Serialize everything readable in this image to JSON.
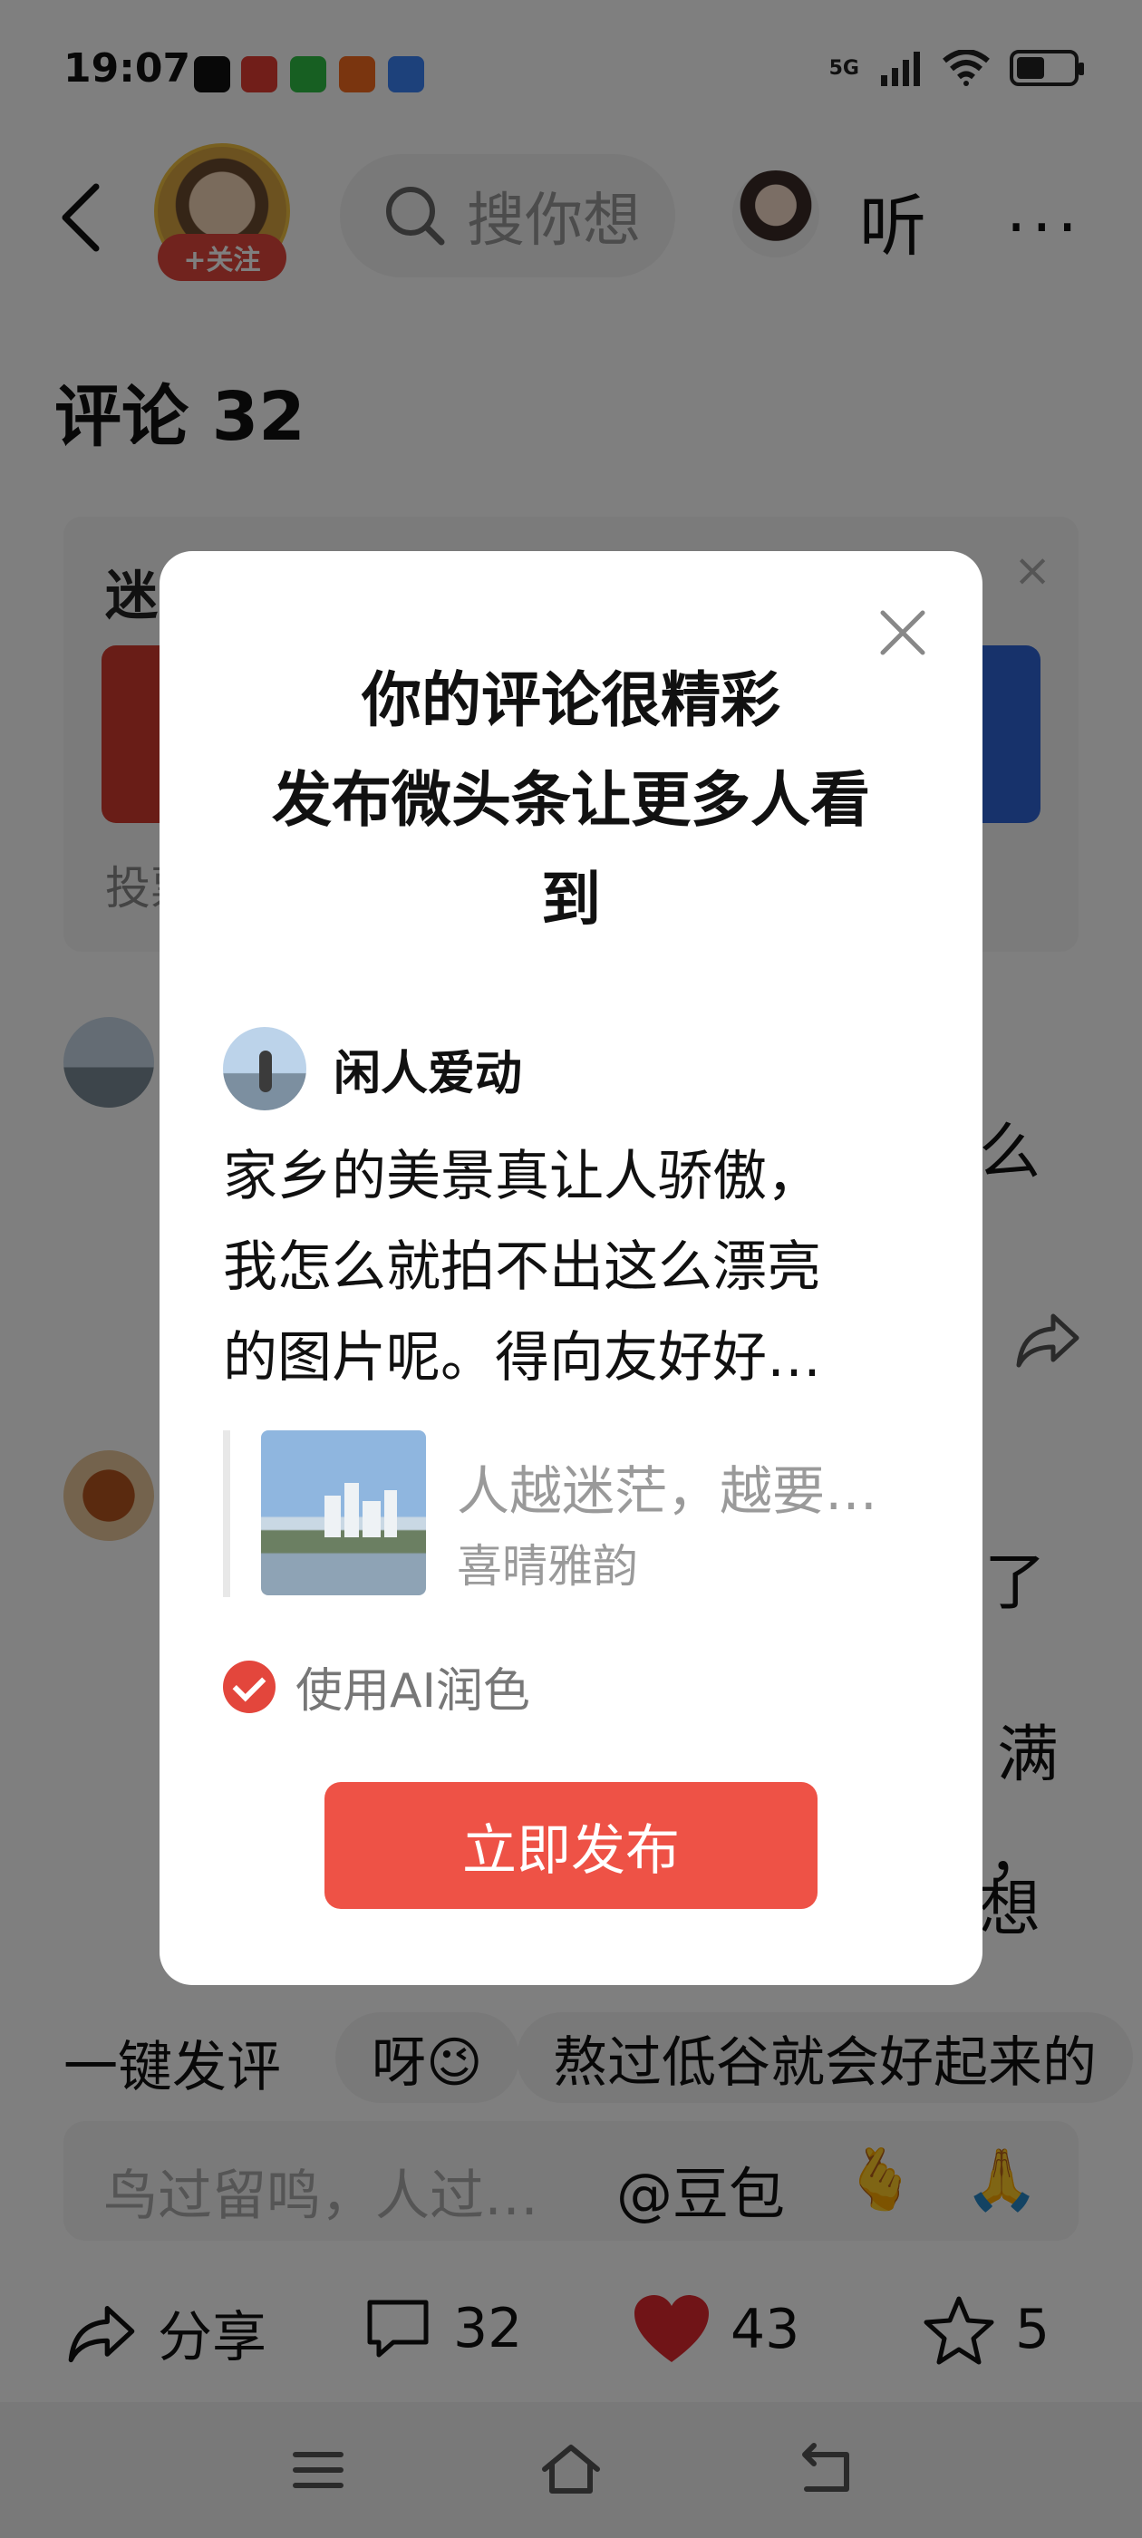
{
  "status_bar": {
    "time": "19:07",
    "network": "5G",
    "battery_level": 0.5,
    "app_icons": [
      "tiktok-icon",
      "toutiao-icon",
      "wechat-icon",
      "taobao-icon",
      "baidu-icon"
    ]
  },
  "header": {
    "follow_label": "+关注",
    "search_placeholder": "搜你想",
    "listen_label": "听",
    "more_label": "···"
  },
  "section_title": "评论 32",
  "background_card": {
    "title": "迷",
    "close": "×",
    "footer": "投票"
  },
  "comments": {
    "c1_frag": "么",
    "c2_frag1": "了",
    "c2_frag2": "满",
    "c2_frag3": "，",
    "c2_frag4": "想"
  },
  "quick_replies": {
    "lead": "一键发评",
    "chip1": "呀😉",
    "chip2": "熬过低谷就会好起来的"
  },
  "comment_input": {
    "placeholder": "鸟过留鸣，人过…",
    "mention": "@豆包",
    "emoji1": "🫰",
    "emoji2": "🙏"
  },
  "action_bar": {
    "share_label": "分享",
    "comment_count": "32",
    "like_count": "43",
    "star_count": "5"
  },
  "modal": {
    "close": "×",
    "title_line1": "你的评论很精彩",
    "title_line2": "发布微头条让更多人看",
    "title_line3": "到",
    "username": "闲人爱动",
    "comment_line1": "家乡的美景真让人骄傲，",
    "comment_line2": "我怎么就拍不出这么漂亮",
    "comment_line3": "的图片呢。得向友好好…",
    "quote_title": "人越迷茫，越要…",
    "quote_author": "喜晴雅韵",
    "ai_label": "使用AI润色",
    "ai_checked": true,
    "publish_label": "立即发布"
  },
  "colors": {
    "accent_red": "#ee5246",
    "follow_red": "#e3463c",
    "like_red": "#e0282e"
  }
}
